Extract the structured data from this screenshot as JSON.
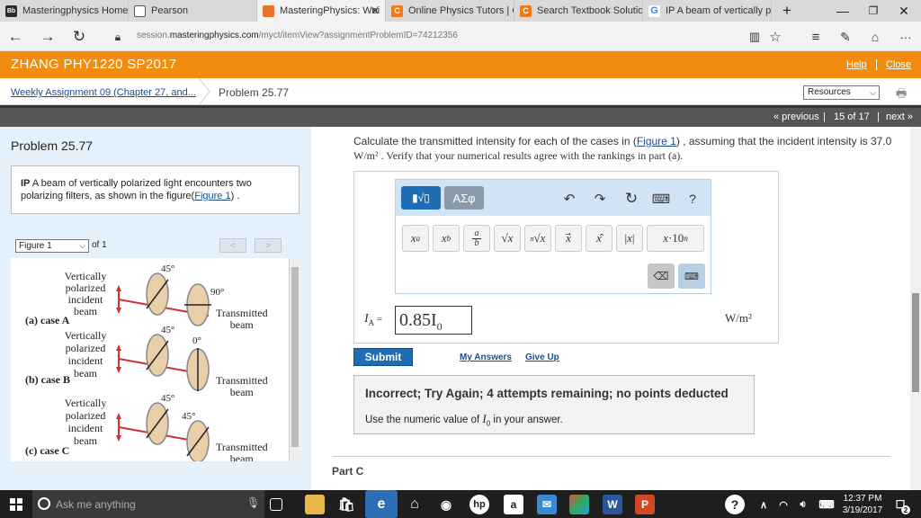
{
  "browser": {
    "tabs": [
      {
        "title": "Masteringphysics Homew",
        "icon_label": "Bb",
        "icon_color": "#2b2b2b",
        "active": false
      },
      {
        "title": "Pearson",
        "icon_label": "",
        "icon_color": "#5a5a8a",
        "active": false
      },
      {
        "title": "MasteringPhysics: Wei",
        "icon_label": "",
        "icon_color": "#e8712b",
        "active": true
      },
      {
        "title": "Online Physics Tutors | Ch",
        "icon_label": "C",
        "icon_color": "#f07a1a",
        "active": false
      },
      {
        "title": "Search Textbook Solution",
        "icon_label": "C",
        "icon_color": "#f07a1a",
        "active": false
      },
      {
        "title": "IP A beam of vertically pol",
        "icon_label": "G",
        "icon_color": "#4285f4",
        "active": false
      }
    ],
    "new_tab_symbol": "+",
    "url_prefix": "session.",
    "url_domain": "masteringphysics.com",
    "url_path": "/myct/itemView?assignmentProblemID=74212356"
  },
  "header": {
    "course": "ZHANG PHY1220 SP2017",
    "help": "Help",
    "close": "Close",
    "bg_color": "#f28c0f"
  },
  "breadcrumb": {
    "assignment": "Weekly Assignment 09 (Chapter 27, and...",
    "current": "Problem 25.77",
    "resources": "Resources"
  },
  "pager": {
    "previous": "« previous",
    "position": "15 of 17",
    "next": "next »"
  },
  "problem": {
    "title": "Problem 25.77",
    "intro_bold": "IP",
    "intro_text": " A beam of vertically polarized light encounters two polarizing filters, as shown in the figure(",
    "intro_link": "Figure 1",
    "intro_end": ") .",
    "figure_select": "Figure 1",
    "figure_of": "of 1",
    "figure": {
      "cases": [
        {
          "label": "(a) case A",
          "incident": [
            "Vertically",
            "polarized",
            "incident beam"
          ],
          "angle1": "45°",
          "angle2": "90°",
          "out": [
            "Transmitted",
            "beam"
          ]
        },
        {
          "label": "(b) case B",
          "incident": [
            "Vertically",
            "polarized",
            "incident beam"
          ],
          "angle1": "45°",
          "angle2": "0°",
          "out": [
            "Transmitted",
            "beam"
          ]
        },
        {
          "label": "(c) case C",
          "incident": [
            "Vertically",
            "polarized",
            "incident beam"
          ],
          "angle1": "45°",
          "angle2": "45°",
          "out": [
            "Transmitted",
            "beam"
          ]
        }
      ]
    }
  },
  "question": {
    "text_before": "Calculate the transmitted intensity for each of the cases in (",
    "link": "Figure 1",
    "text_after": ") , assuming that the incident intensity is 37.0",
    "unit_line": "W/m² . Verify that your numerical results agree with the rankings in part (a)."
  },
  "editor": {
    "mode_math": "▮√▯",
    "mode_symbols": "ΑΣφ",
    "actions": [
      "undo-icon",
      "redo-icon",
      "reset-icon",
      "keyboard-icon",
      "help-icon"
    ],
    "help_label": "?",
    "templates": [
      "xᵃ",
      "x_b",
      "a/b",
      "√x",
      "ⁿ√x",
      "x⃗",
      "x̂",
      "|x|",
      "x·10ⁿ"
    ]
  },
  "answer": {
    "label": "I",
    "label_sub": "A",
    "label_eq": " =",
    "value": "0.85I",
    "value_sub": "0",
    "unit": "W/m²"
  },
  "actions": {
    "submit": "Submit",
    "my_answers": "My Answers",
    "give_up": "Give Up"
  },
  "feedback": {
    "title": "Incorrect; Try Again; 4 attempts remaining; no points deducted",
    "message_before": "Use the numeric value of ",
    "message_var": "I",
    "message_sub": "0",
    "message_after": " in your answer."
  },
  "part_c": "Part C",
  "taskbar": {
    "search_placeholder": "Ask me anything",
    "time": "12:37 PM",
    "date": "3/19/2017",
    "notification_count": "2"
  }
}
